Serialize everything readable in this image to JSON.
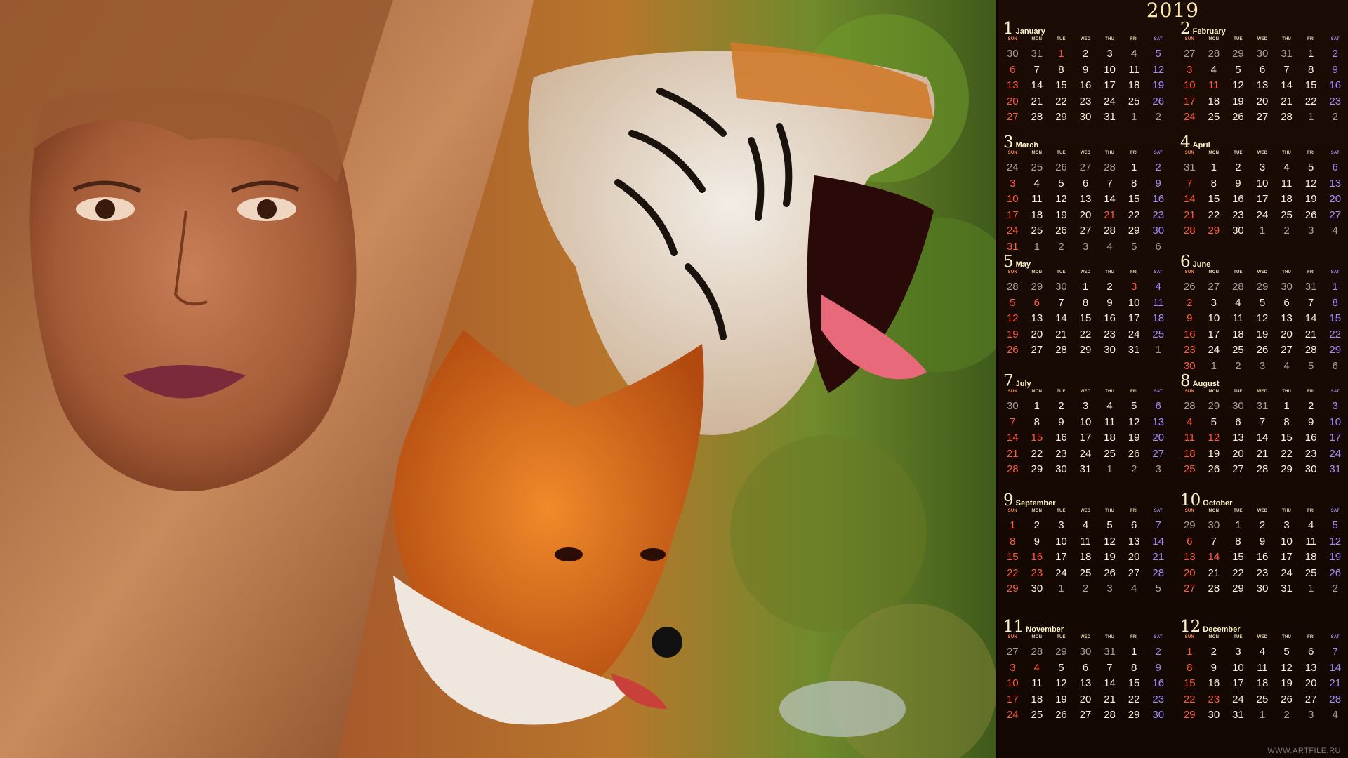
{
  "year": "2019",
  "dows": [
    "SUN",
    "MON",
    "TUE",
    "WED",
    "THU",
    "FRI",
    "SAT"
  ],
  "watermark": "WWW.ARTFILE.RU",
  "months": [
    {
      "num": "1",
      "name": "January",
      "holidays": [
        "1"
      ],
      "rows": [
        [
          "30",
          "31",
          "1",
          "2",
          "3",
          "4",
          "5"
        ],
        [
          "6",
          "7",
          "8",
          "9",
          "10",
          "11",
          "12"
        ],
        [
          "13",
          "14",
          "15",
          "16",
          "17",
          "18",
          "19"
        ],
        [
          "20",
          "21",
          "22",
          "23",
          "24",
          "25",
          "26"
        ],
        [
          "27",
          "28",
          "29",
          "30",
          "31",
          "1",
          "2"
        ]
      ]
    },
    {
      "num": "2",
      "name": "February",
      "holidays": [
        "11"
      ],
      "rows": [
        [
          "27",
          "28",
          "29",
          "30",
          "31",
          "1",
          "2"
        ],
        [
          "3",
          "4",
          "5",
          "6",
          "7",
          "8",
          "9"
        ],
        [
          "10",
          "11",
          "12",
          "13",
          "14",
          "15",
          "16"
        ],
        [
          "17",
          "18",
          "19",
          "20",
          "21",
          "22",
          "23"
        ],
        [
          "24",
          "25",
          "26",
          "27",
          "28",
          "1",
          "2"
        ]
      ]
    },
    {
      "num": "3",
      "name": "March",
      "holidays": [
        "21"
      ],
      "rows": [
        [
          "24",
          "25",
          "26",
          "27",
          "28",
          "1",
          "2"
        ],
        [
          "3",
          "4",
          "5",
          "6",
          "7",
          "8",
          "9"
        ],
        [
          "10",
          "11",
          "12",
          "13",
          "14",
          "15",
          "16"
        ],
        [
          "17",
          "18",
          "19",
          "20",
          "21",
          "22",
          "23"
        ],
        [
          "24",
          "25",
          "26",
          "27",
          "28",
          "29",
          "30"
        ],
        [
          "31",
          "1",
          "2",
          "3",
          "4",
          "5",
          "6"
        ]
      ]
    },
    {
      "num": "4",
      "name": "April",
      "holidays": [
        "29"
      ],
      "rows": [
        [
          "31",
          "1",
          "2",
          "3",
          "4",
          "5",
          "6"
        ],
        [
          "7",
          "8",
          "9",
          "10",
          "11",
          "12",
          "13"
        ],
        [
          "14",
          "15",
          "16",
          "17",
          "18",
          "19",
          "20"
        ],
        [
          "21",
          "22",
          "23",
          "24",
          "25",
          "26",
          "27"
        ],
        [
          "28",
          "29",
          "30",
          "1",
          "2",
          "3",
          "4"
        ]
      ]
    },
    {
      "num": "5",
      "name": "May",
      "holidays": [
        "3",
        "6"
      ],
      "rows": [
        [
          "28",
          "29",
          "30",
          "1",
          "2",
          "3",
          "4"
        ],
        [
          "5",
          "6",
          "7",
          "8",
          "9",
          "10",
          "11"
        ],
        [
          "12",
          "13",
          "14",
          "15",
          "16",
          "17",
          "18"
        ],
        [
          "19",
          "20",
          "21",
          "22",
          "23",
          "24",
          "25"
        ],
        [
          "26",
          "27",
          "28",
          "29",
          "30",
          "31",
          "1"
        ]
      ]
    },
    {
      "num": "6",
      "name": "June",
      "holidays": [],
      "rows": [
        [
          "26",
          "27",
          "28",
          "29",
          "30",
          "31",
          "1"
        ],
        [
          "2",
          "3",
          "4",
          "5",
          "6",
          "7",
          "8"
        ],
        [
          "9",
          "10",
          "11",
          "12",
          "13",
          "14",
          "15"
        ],
        [
          "16",
          "17",
          "18",
          "19",
          "20",
          "21",
          "22"
        ],
        [
          "23",
          "24",
          "25",
          "26",
          "27",
          "28",
          "29"
        ],
        [
          "30",
          "1",
          "2",
          "3",
          "4",
          "5",
          "6"
        ]
      ]
    },
    {
      "num": "7",
      "name": "July",
      "holidays": [
        "15"
      ],
      "rows": [
        [
          "30",
          "1",
          "2",
          "3",
          "4",
          "5",
          "6"
        ],
        [
          "7",
          "8",
          "9",
          "10",
          "11",
          "12",
          "13"
        ],
        [
          "14",
          "15",
          "16",
          "17",
          "18",
          "19",
          "20"
        ],
        [
          "21",
          "22",
          "23",
          "24",
          "25",
          "26",
          "27"
        ],
        [
          "28",
          "29",
          "30",
          "31",
          "1",
          "2",
          "3"
        ]
      ]
    },
    {
      "num": "8",
      "name": "August",
      "holidays": [
        "12"
      ],
      "rows": [
        [
          "28",
          "29",
          "30",
          "31",
          "1",
          "2",
          "3"
        ],
        [
          "4",
          "5",
          "6",
          "7",
          "8",
          "9",
          "10"
        ],
        [
          "11",
          "12",
          "13",
          "14",
          "15",
          "16",
          "17"
        ],
        [
          "18",
          "19",
          "20",
          "21",
          "22",
          "23",
          "24"
        ],
        [
          "25",
          "26",
          "27",
          "28",
          "29",
          "30",
          "31"
        ]
      ]
    },
    {
      "num": "9",
      "name": "September",
      "holidays": [
        "16",
        "23"
      ],
      "rows": [
        [
          "1",
          "2",
          "3",
          "4",
          "5",
          "6",
          "7"
        ],
        [
          "8",
          "9",
          "10",
          "11",
          "12",
          "13",
          "14"
        ],
        [
          "15",
          "16",
          "17",
          "18",
          "19",
          "20",
          "21"
        ],
        [
          "22",
          "23",
          "24",
          "25",
          "26",
          "27",
          "28"
        ],
        [
          "29",
          "30",
          "1",
          "2",
          "3",
          "4",
          "5"
        ]
      ]
    },
    {
      "num": "10",
      "name": "October",
      "holidays": [
        "14"
      ],
      "rows": [
        [
          "29",
          "30",
          "1",
          "2",
          "3",
          "4",
          "5"
        ],
        [
          "6",
          "7",
          "8",
          "9",
          "10",
          "11",
          "12"
        ],
        [
          "13",
          "14",
          "15",
          "16",
          "17",
          "18",
          "19"
        ],
        [
          "20",
          "21",
          "22",
          "23",
          "24",
          "25",
          "26"
        ],
        [
          "27",
          "28",
          "29",
          "30",
          "31",
          "1",
          "2"
        ]
      ]
    },
    {
      "num": "11",
      "name": "November",
      "holidays": [
        "4"
      ],
      "rows": [
        [
          "27",
          "28",
          "29",
          "30",
          "31",
          "1",
          "2"
        ],
        [
          "3",
          "4",
          "5",
          "6",
          "7",
          "8",
          "9"
        ],
        [
          "10",
          "11",
          "12",
          "13",
          "14",
          "15",
          "16"
        ],
        [
          "17",
          "18",
          "19",
          "20",
          "21",
          "22",
          "23"
        ],
        [
          "24",
          "25",
          "26",
          "27",
          "28",
          "29",
          "30"
        ]
      ]
    },
    {
      "num": "12",
      "name": "December",
      "holidays": [
        "23"
      ],
      "rows": [
        [
          "1",
          "2",
          "3",
          "4",
          "5",
          "6",
          "7"
        ],
        [
          "8",
          "9",
          "10",
          "11",
          "12",
          "13",
          "14"
        ],
        [
          "15",
          "16",
          "17",
          "18",
          "19",
          "20",
          "21"
        ],
        [
          "22",
          "23",
          "24",
          "25",
          "26",
          "27",
          "28"
        ],
        [
          "29",
          "30",
          "31",
          "1",
          "2",
          "3",
          "4"
        ]
      ]
    }
  ]
}
